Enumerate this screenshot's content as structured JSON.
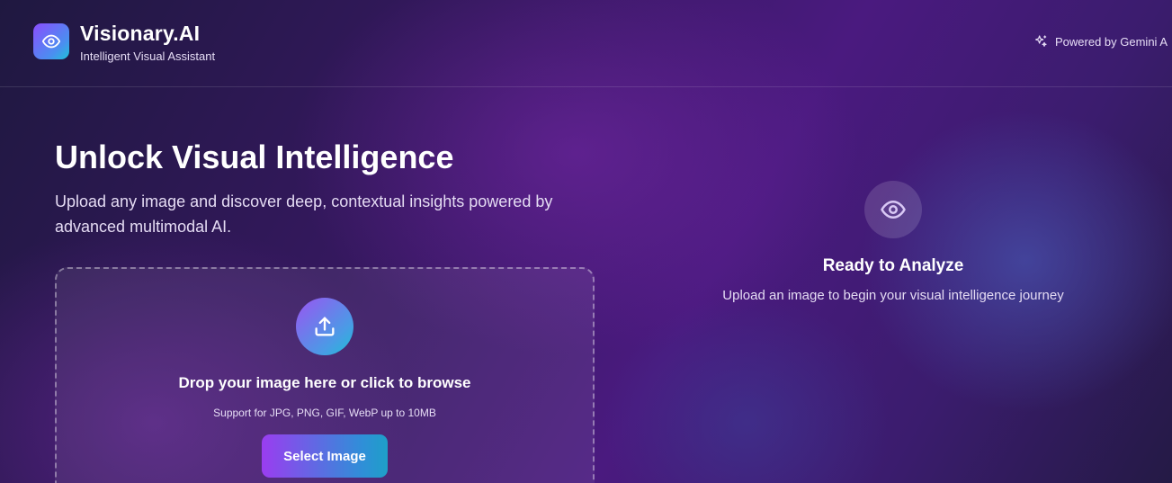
{
  "brand": {
    "name": "Visionary.AI",
    "tagline": "Intelligent Visual Assistant",
    "logo_icon": "eye-icon",
    "accent_gradient": [
      "#8b4dff",
      "#1ec3d8"
    ]
  },
  "header": {
    "powered_by": "Powered by Gemini A",
    "powered_icon": "sparkles-icon"
  },
  "hero": {
    "title": "Unlock Visual Intelligence",
    "description": "Upload any image and discover deep, contextual insights powered by advanced multimodal AI."
  },
  "upload": {
    "icon": "upload-icon",
    "title": "Drop your image here or click to browse",
    "support_text": "Support for JPG, PNG, GIF, WebP up to 10MB",
    "button_label": "Select Image"
  },
  "analysis": {
    "icon": "eye-icon",
    "title": "Ready to Analyze",
    "description": "Upload an image to begin your visual intelligence journey"
  }
}
